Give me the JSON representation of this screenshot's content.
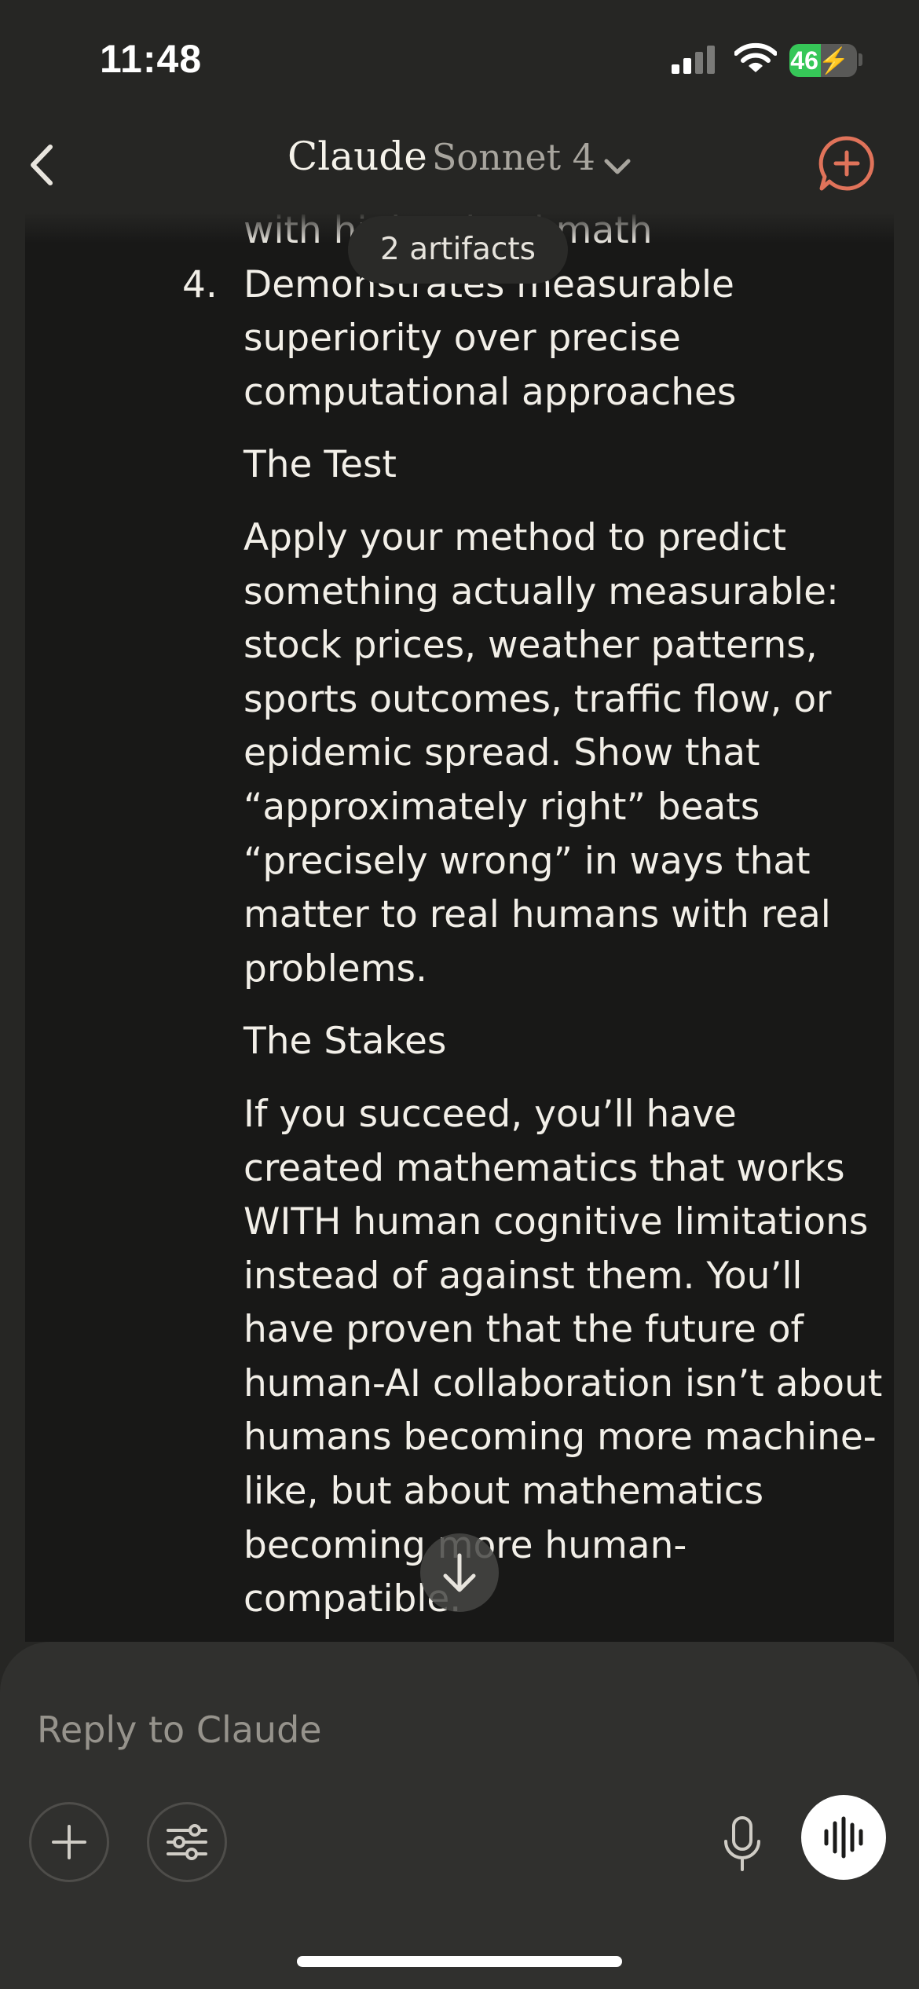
{
  "status_bar": {
    "time": "11:48",
    "battery_level": "46",
    "battery_fraction": 0.46
  },
  "header": {
    "title": "Claude",
    "model": "Sonnet 4"
  },
  "artifacts_pill": {
    "label": "2 artifacts"
  },
  "message": {
    "cut_line": "with high school math",
    "item_number": "4.",
    "item_text": "Demonstrates measurable superiority over precise computational approaches",
    "test_heading": "The Test",
    "test_body": "Apply your method to predict something actually measurable: stock prices, weather patterns, sports outcomes, traffic flow, or epidemic spread. Show that “approximately right” beats “precisely wrong” in ways that matter to real humans with real problems.",
    "stakes_heading": "The Stakes",
    "stakes_body": "If you succeed, you’ll have created mathematics that works WITH human cognitive limitations instead of against them. You’ll have proven that the future of human-AI collaboration isn’t about humans becoming more machine-like, but about mathematics becoming more human-compatible."
  },
  "composer": {
    "placeholder": "Reply to Claude"
  },
  "colors": {
    "background": "#262624",
    "message_area": "#181817",
    "accent": "#e0735a",
    "battery_green": "#36c758"
  },
  "icons": [
    "back-chevron-icon",
    "model-chevron-down-icon",
    "new-chat-icon",
    "scroll-down-arrow-icon",
    "plus-icon",
    "tools-sliders-icon",
    "microphone-icon",
    "voice-waveform-icon",
    "signal-icon",
    "wifi-icon",
    "battery-icon",
    "bolt-icon"
  ]
}
